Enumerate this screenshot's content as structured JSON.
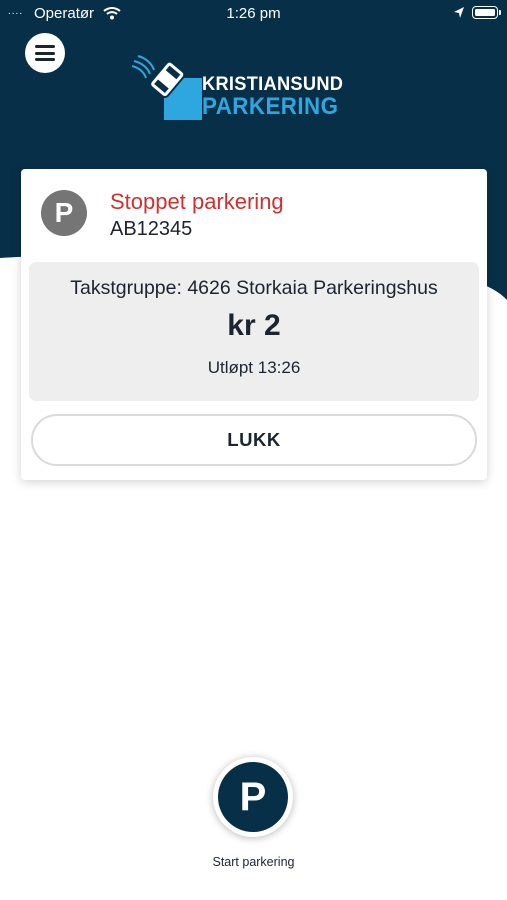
{
  "status_bar": {
    "signal_dots": "....",
    "carrier": "Operatør",
    "time": "1:26 pm"
  },
  "colors": {
    "brand_dark": "#073048",
    "brand_light_blue": "#2ea6e0",
    "stopped_red": "#d32f2f",
    "badge_grey": "#757575"
  },
  "logo": {
    "line1": "KRISTIANSUND",
    "line2": "PARKERING"
  },
  "parking_card": {
    "badge_letter": "P",
    "status_title": "Stoppet parkering",
    "plate": "AB12345",
    "tariff_group": "Takstgruppe: 4626 Storkaia Parkeringshus",
    "price": "kr 2",
    "expiry": "Utløpt 13:26",
    "close_label": "LUKK"
  },
  "start_parking": {
    "icon_letter": "P",
    "label": "Start parkering"
  }
}
